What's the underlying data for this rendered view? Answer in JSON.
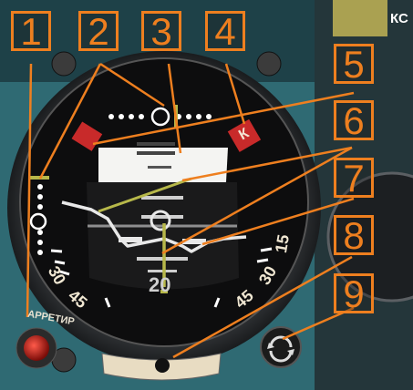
{
  "callouts": {
    "c1": "1",
    "c2": "2",
    "c3": "3",
    "c4": "4",
    "c5": "5",
    "c6": "6",
    "c7": "7",
    "c8": "8",
    "c9": "9"
  },
  "instrument": {
    "warning_flag_letter": "К",
    "scale_left_30": "30",
    "scale_left_45": "45",
    "scale_right_15": "15",
    "scale_right_30": "30",
    "scale_right_45": "45",
    "center_readout": "20",
    "cage_label": "АРРЕТИР",
    "top_right_label": "КС"
  },
  "colors": {
    "callout_orange": "#ee7f1f",
    "panel_teal": "#2f6a73",
    "gauge_black": "#111111",
    "flag_red": "#c82a2a",
    "bar_yellow": "#b7b84a"
  }
}
